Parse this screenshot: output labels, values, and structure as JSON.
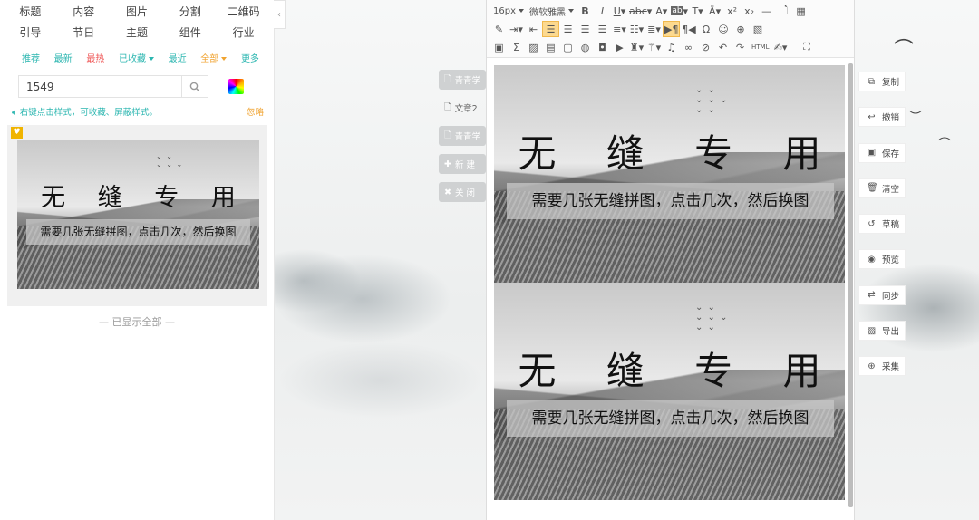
{
  "categories": [
    {
      "label": "标题"
    },
    {
      "label": "内容"
    },
    {
      "label": "图片"
    },
    {
      "label": "分割"
    },
    {
      "label": "二维码"
    },
    {
      "label": "引导"
    },
    {
      "label": "节日"
    },
    {
      "label": "主题"
    },
    {
      "label": "组件"
    },
    {
      "label": "行业"
    }
  ],
  "filters": {
    "recommend": "推荐",
    "newest": "最新",
    "hottest": "最热",
    "favorited": "已收藏",
    "recent": "最近",
    "all": "全部",
    "more": "更多"
  },
  "search": {
    "value": "1549"
  },
  "tip": {
    "text": "右键点击样式，可收藏、屏蔽样式。",
    "ignore": "忽略"
  },
  "template": {
    "title": "无 缝 专 用",
    "subtitle": "需要几张无缝拼图，点击几次，然后换图"
  },
  "shown_all": "— 已显示全部 —",
  "middle_actions": {
    "item1": "青青学",
    "item2": "文章2",
    "item3": "青青学",
    "new": "新 建",
    "close": "关 闭"
  },
  "toolbar": {
    "font_size": "16px",
    "font_family": "微软雅黑",
    "html": "HTML"
  },
  "right_actions": {
    "copy": "复制",
    "undo": "撤销",
    "save": "保存",
    "clear": "清空",
    "draft": "草稿",
    "preview": "预览",
    "sync": "同步",
    "export": "导出",
    "collect": "采集"
  },
  "colors": {
    "accent": "#2bb6b0",
    "hot": "#ef5b5b",
    "orange": "#f0a330",
    "highlight": "#fcd98f"
  }
}
